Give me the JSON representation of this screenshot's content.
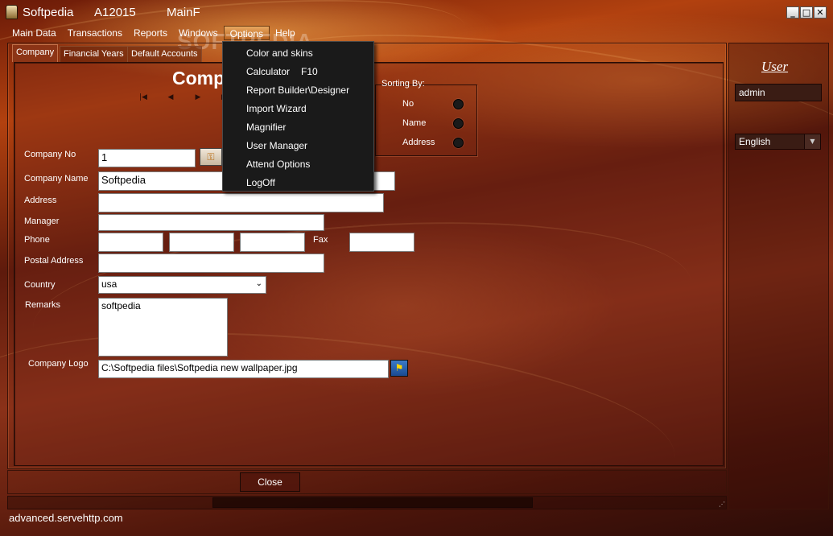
{
  "window": {
    "title_app": "Softpedia",
    "title_code": "A12015",
    "title_form": "MainF",
    "minimize": "_",
    "maximize": "□",
    "close": "✕"
  },
  "menubar": {
    "items": [
      "Main Data",
      "Transactions",
      "Reports",
      "Windows",
      "Options",
      "Help"
    ],
    "active": "Options"
  },
  "watermark": "SOFTPEDIA",
  "tabs": [
    "Company",
    "Financial Years",
    "Default Accounts"
  ],
  "active_tab": "Company",
  "page_heading": "Comp",
  "form": {
    "company_no_label": "Company No",
    "company_no_value": "1",
    "company_name_label": "Company Name",
    "company_name_value": "Softpedia",
    "address_label": "Address",
    "address_value": "",
    "manager_label": "Manager",
    "manager_value": "",
    "phone_label": "Phone",
    "phone_values": [
      "",
      "",
      ""
    ],
    "fax_label": "Fax",
    "fax_value": "",
    "postal_label": "Postal Address",
    "postal_value": "",
    "country_label": "Country",
    "country_value": "usa",
    "remarks_label": "Remarks",
    "remarks_value": "softpedia",
    "logo_label": "Company Logo",
    "logo_value": "C:\\Softpedia files\\Softpedia new wallpaper.jpg"
  },
  "sorting": {
    "title": "Sorting By:",
    "options": [
      "No",
      "Name",
      "Address"
    ]
  },
  "options_menu": {
    "items": [
      {
        "label": "Color and skins",
        "shortcut": ""
      },
      {
        "label": "Calculator",
        "shortcut": "F10"
      },
      {
        "label": "Report Builder\\Designer",
        "shortcut": ""
      },
      {
        "label": "Import Wizard",
        "shortcut": ""
      },
      {
        "label": "Magnifier",
        "shortcut": ""
      },
      {
        "label": "User Manager",
        "shortcut": ""
      },
      {
        "label": "Attend Options",
        "shortcut": ""
      },
      {
        "label": "LogOff",
        "shortcut": ""
      }
    ]
  },
  "bottom": {
    "close_label": "Close"
  },
  "side": {
    "user_heading": "User",
    "user_value": "admin",
    "language_value": "English"
  },
  "status_text": "advanced.servehttp.com",
  "colors": {
    "background_dark": "#5e1a0c",
    "background_glow": "#ffbe5a",
    "menu_active": "#d8863e",
    "dropdown_bg": "#1a1a1a"
  }
}
